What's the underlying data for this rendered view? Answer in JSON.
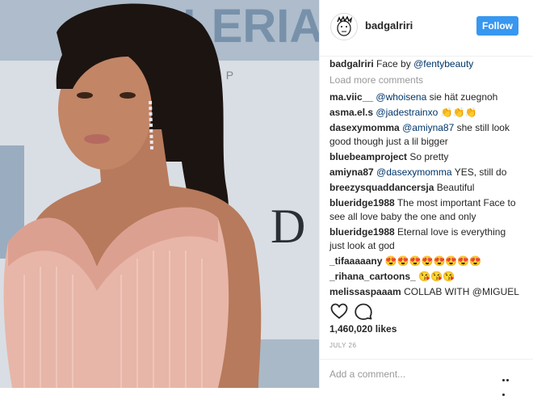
{
  "header": {
    "username": "badgalriri",
    "follow_label": "Follow"
  },
  "photo": {
    "backdrop_text_1": "VALERIAN",
    "backdrop_text_2": "T LA   MILLE P",
    "backdrop_text_3": "D"
  },
  "caption": {
    "user": "badgalriri",
    "text": "Face by ",
    "mention": "@fentybeauty"
  },
  "load_more": "Load more comments",
  "comments": [
    {
      "user": "ma.viic__",
      "mention": "@whoisena",
      "text": " sie hät zuegnoh"
    },
    {
      "user": "asma.el.s",
      "mention": "@jadestrainxo",
      "text": " 👏👏👏"
    },
    {
      "user": "dasexymomma",
      "mention": "@amiyna87",
      "text": " she still look good though just a lil bigger"
    },
    {
      "user": "bluebeamproject",
      "mention": "",
      "text": "So pretty"
    },
    {
      "user": "amiyna87",
      "mention": "@dasexymomma",
      "text": " YES, still do"
    },
    {
      "user": "breezysquaddancersja",
      "mention": "",
      "text": "Beautiful"
    },
    {
      "user": "blueridge1988",
      "mention": "",
      "text": "The most important Face to see all love baby the one and only"
    },
    {
      "user": "blueridge1988",
      "mention": "",
      "text": "Eternal love is everything just look at god"
    },
    {
      "user": "_tifaaaaany",
      "mention": "",
      "text": "😍😍😍😍😍😍😍😍"
    },
    {
      "user": "_rihana_cartoons_",
      "mention": "",
      "text": "😘😘😘"
    },
    {
      "user": "melissaspaaam",
      "mention": "",
      "text": "COLLAB WITH @MIGUEL"
    }
  ],
  "actions": {
    "like_icon": "heart-icon",
    "comment_icon": "comment-icon"
  },
  "likes": "1,460,020 likes",
  "date": "JULY 26",
  "add_comment": {
    "placeholder": "Add a comment..."
  },
  "colors": {
    "accent": "#3897f0",
    "mention": "#003569",
    "muted": "#999999"
  }
}
